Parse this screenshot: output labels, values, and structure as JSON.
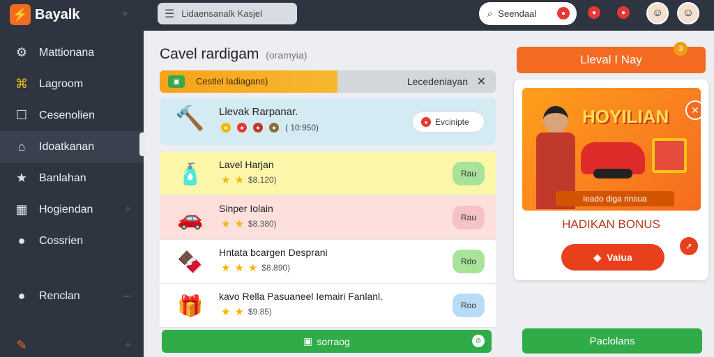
{
  "brand": {
    "name": "Bayalk"
  },
  "sidebar": {
    "items": [
      {
        "label": "Mattionana",
        "icon": "gear-icon",
        "glyph": "⚙"
      },
      {
        "label": "Lagroom",
        "icon": "puzzle-icon",
        "glyph": "⌘"
      },
      {
        "label": "Cesenolien",
        "icon": "square-icon",
        "glyph": "☐"
      },
      {
        "label": "Idoatkanan",
        "icon": "bank-icon",
        "glyph": "⌂"
      },
      {
        "label": "Banlahan",
        "icon": "star-icon",
        "glyph": "★"
      },
      {
        "label": "Hogiendan",
        "icon": "layout-icon",
        "glyph": "▦"
      },
      {
        "label": "Cossrien",
        "icon": "user-icon",
        "glyph": "●"
      }
    ],
    "bottom_item": {
      "label": "Renclan",
      "icon": "user-icon",
      "glyph": "●"
    }
  },
  "topbar": {
    "search_text": "Lidaensanalk Kasjel",
    "search2_text": "Seendaal"
  },
  "main": {
    "title": "Cavel rardigam",
    "title_note": "(oramyia)",
    "progress": {
      "label": "Cestlel ladiagans)",
      "right_label": "Lecedeniayan",
      "value": 0.53
    },
    "feature": {
      "title": "Llevak Rarpanar.",
      "meta": "( 10:950)",
      "button_label": "Evcinipte"
    },
    "items": [
      {
        "title": "Lavel Harjan",
        "price": "$8.120)",
        "button_label": "Rau",
        "bg": "#fbf6a8",
        "btn_color": "#a8e39a",
        "emoji": "🧴",
        "stars": 2
      },
      {
        "title": "Sinper Iolain",
        "price": "$8.380)",
        "button_label": "Rau",
        "bg": "#fde0dc",
        "btn_color": "#f7c1c8",
        "emoji": "🚗",
        "stars": 2
      },
      {
        "title": "Hntata bcargen Desprani",
        "price": "$8.890)",
        "button_label": "Rdo",
        "bg": "#ffffff",
        "btn_color": "#a8e39a",
        "emoji": "🍫",
        "stars": 3
      },
      {
        "title": "kavo Rella Pasuaneel Iemairi Fanlanl.",
        "price": "$9.85)",
        "button_label": "Roo",
        "bg": "#ffffff",
        "btn_color": "#b8dcf5",
        "emoji": "🎁",
        "stars": 2
      }
    ],
    "footer_label": "sorraog"
  },
  "right": {
    "level_label": "Lleval I Nay",
    "level_badge": "3",
    "promo_art_title": "HOYILIAN",
    "promo_ribbon": "leado diga rinsua",
    "promo_title": "HADIKAN BONUS",
    "promo_button": "Vaiua",
    "footer_label": "Paclolans"
  },
  "colors": {
    "accent": "#f26b21",
    "success": "#2fab47",
    "sidebar": "#2e3440"
  }
}
